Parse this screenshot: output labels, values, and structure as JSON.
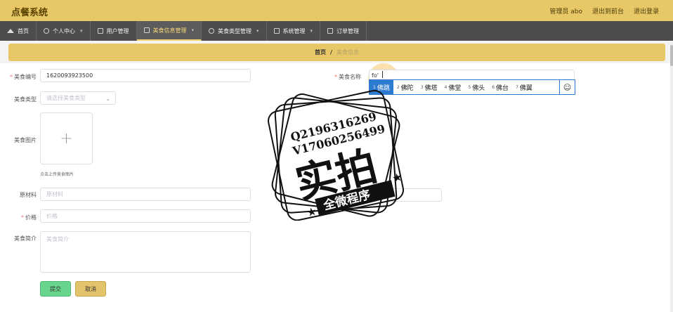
{
  "app": {
    "title": "点餐系统"
  },
  "top_links": {
    "admin": "管理员 abo",
    "front": "退出到前台",
    "logout": "退出登录"
  },
  "nav": [
    {
      "label": "首页",
      "icon": "home-icon"
    },
    {
      "label": "个人中心",
      "icon": "user-icon"
    },
    {
      "label": "用户管理",
      "icon": "users-icon"
    },
    {
      "label": "美食信息管理",
      "icon": "food-icon",
      "active": true
    },
    {
      "label": "美食类型管理",
      "icon": "category-icon"
    },
    {
      "label": "系统管理",
      "icon": "settings-icon"
    },
    {
      "label": "订单管理",
      "icon": "order-icon"
    }
  ],
  "breadcrumb": {
    "home": "首页",
    "separator": "/",
    "current": "美食信息"
  },
  "form": {
    "code": {
      "label": "美食编号",
      "value": "1620093923500",
      "required": true
    },
    "name": {
      "label": "美食名称",
      "value": "fo'",
      "required": true
    },
    "type": {
      "label": "美食类型",
      "placeholder": "请选择美食类型"
    },
    "image": {
      "label": "美食图片",
      "hint": "点击上传美食图片"
    },
    "ingredients": {
      "label": "原材料",
      "placeholder": "原材料"
    },
    "price": {
      "label": "价格",
      "placeholder": "价格",
      "required": true
    },
    "intro": {
      "label": "美食简介",
      "placeholder": "美食简介"
    },
    "submit": "提交",
    "cancel": "取消"
  },
  "ime": {
    "candidates": [
      {
        "n": "1",
        "text": "佛跳"
      },
      {
        "n": "2",
        "text": "佛陀"
      },
      {
        "n": "3",
        "text": "佛塔"
      },
      {
        "n": "4",
        "text": "佛堂"
      },
      {
        "n": "5",
        "text": "佛头"
      },
      {
        "n": "6",
        "text": "佛台"
      },
      {
        "n": "7",
        "text": "佛翼"
      }
    ],
    "selected_index": 0,
    "emoji_icon": "☺"
  },
  "watermark": {
    "line1": "Q2196316269",
    "line2": "V17060256499",
    "main": "实拍",
    "ribbon": "全微程序"
  },
  "colors": {
    "accent": "#e8c766",
    "nav": "#4d4d4d",
    "ime_blue": "#2d7bd0",
    "submit": "#68d48c",
    "cancel": "#e3c46c"
  }
}
